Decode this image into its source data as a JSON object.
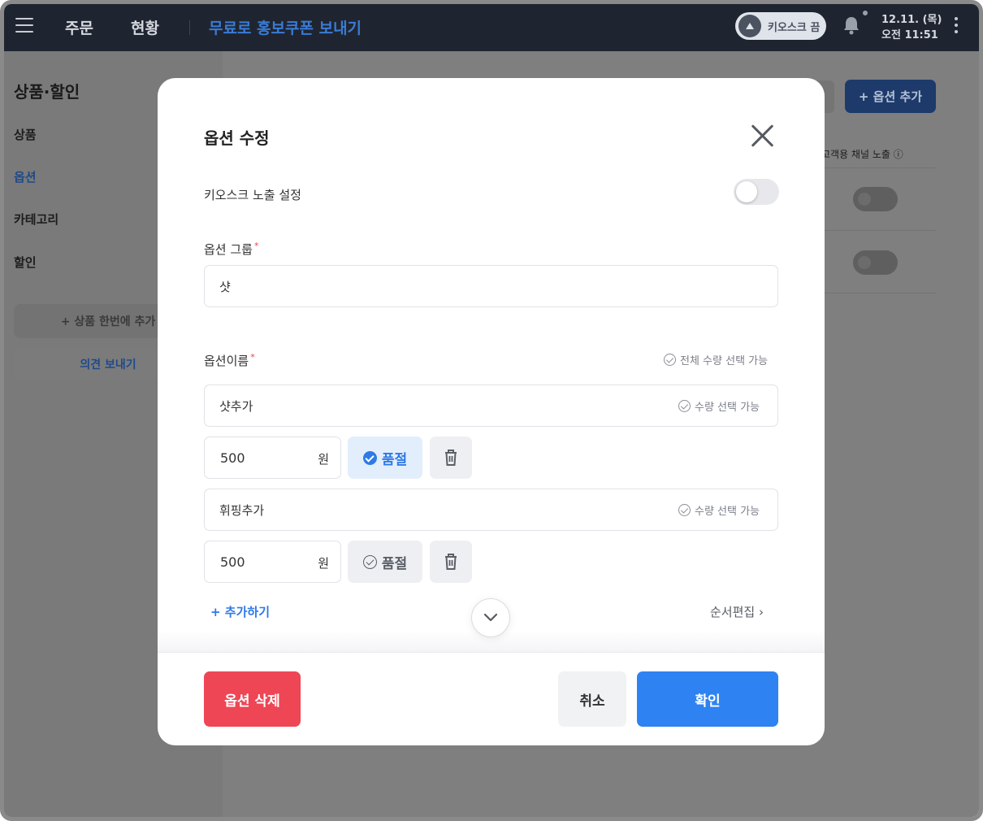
{
  "topbar": {
    "nav": [
      "주문",
      "현황"
    ],
    "promo": "무료로 홍보쿠폰 보내기",
    "kiosk_label": "키오스크 끔",
    "date": "12.11. (목)",
    "time": "오전 11:51"
  },
  "sidebar": {
    "title": "상품·할인",
    "items": [
      {
        "label": "상품",
        "active": false
      },
      {
        "label": "옵션",
        "active": true
      },
      {
        "label": "카테고리",
        "active": false
      },
      {
        "label": "할인",
        "active": false
      }
    ],
    "bulk_add_label": "+ 상품 한번에 추가",
    "feedback_label": "의견 보내기"
  },
  "background": {
    "add_option_label": "+ 옵션 추가",
    "column_label": "고객용 채널 노출 ⓘ"
  },
  "modal": {
    "title": "옵션 수정",
    "kiosk_setting_label": "키오스크 노출 설정",
    "kiosk_setting_on": false,
    "group_label": "옵션 그룹",
    "group_value": "샷",
    "name_label": "옵션이름",
    "all_qty_hint": "전체 수량 선택 가능",
    "options": [
      {
        "name": "샷추가",
        "qty_hint": "수량 선택 가능",
        "price": "500",
        "unit": "원",
        "soldout_label": "품절",
        "soldout": true
      },
      {
        "name": "휘핑추가",
        "qty_hint": "수량 선택 가능",
        "price": "500",
        "unit": "원",
        "soldout_label": "품절",
        "soldout": false
      }
    ],
    "add_label": "+ 추가하기",
    "reorder_label": "순서편집 ›",
    "delete_label": "옵션 삭제",
    "cancel_label": "취소",
    "confirm_label": "확인"
  },
  "colors": {
    "accent": "#2f82f1",
    "danger": "#ee4655",
    "topbar": "#1f2530"
  }
}
